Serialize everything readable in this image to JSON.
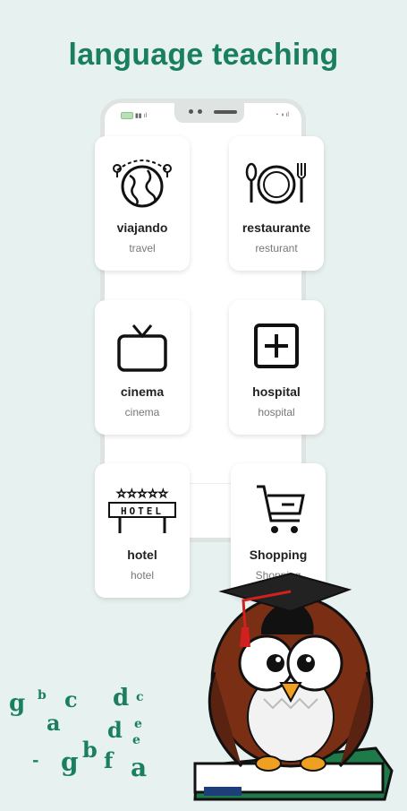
{
  "headline": "language teaching",
  "cards": [
    {
      "title": "viajando",
      "sub": "travel",
      "icon": "globe-icon"
    },
    {
      "title": "restaurante",
      "sub": "resturant",
      "icon": "plate-cutlery-icon"
    },
    {
      "title": "cinema",
      "sub": "cinema",
      "icon": "tv-icon"
    },
    {
      "title": "hospital",
      "sub": "hospital",
      "icon": "plus-box-icon"
    },
    {
      "title": "hotel",
      "sub": "hotel",
      "icon": "hotel-sign-icon"
    },
    {
      "title": "Shopping",
      "sub": "Shopping",
      "icon": "cart-icon"
    }
  ],
  "letters": [
    "g",
    "b",
    "c",
    "d",
    "c",
    "a",
    "d",
    "e",
    "e",
    "g",
    "b",
    "f",
    "a",
    "-"
  ],
  "mascot": "owl-graduate",
  "colors": {
    "accent": "#1a7f5f",
    "background": "#e7f1ef"
  }
}
